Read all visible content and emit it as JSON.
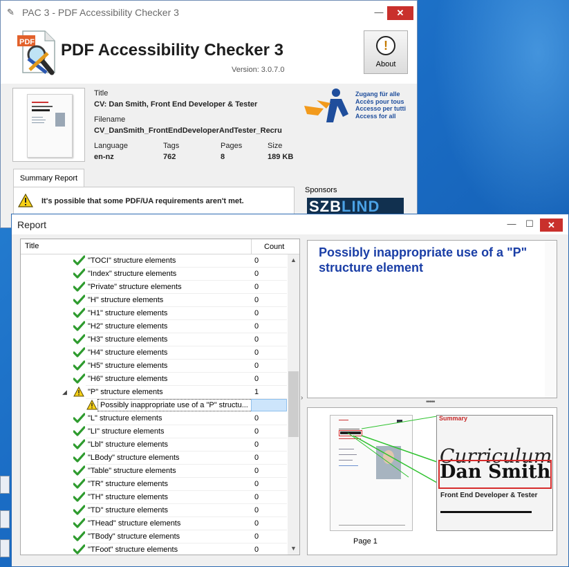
{
  "main_window": {
    "title": "PAC 3 - PDF Accessibility Checker 3",
    "app_name": "PDF Accessibility Checker 3",
    "version": "Version: 3.0.7.0",
    "about_label": "About",
    "window_buttons": {
      "minimize": "—",
      "maximize": "☐",
      "close": "✕"
    }
  },
  "document": {
    "title_label": "Title",
    "title_value": "CV: Dan Smith, Front End Developer & Tester",
    "filename_label": "Filename",
    "filename_value": "CV_DanSmith_FrontEndDeveloperAndTester_Recru",
    "language_label": "Language",
    "language_value": "en-nz",
    "tags_label": "Tags",
    "tags_value": "762",
    "pages_label": "Pages",
    "pages_value": "8",
    "size_label": "Size",
    "size_value": "189 KB"
  },
  "access_for_all": {
    "lines": [
      "Zugang für alle",
      "Accès pour tous",
      "Accesso per tutti",
      "Access for all"
    ]
  },
  "summary": {
    "tab_label": "Summary Report",
    "message": "It's possible that some PDF/UA requirements aren't met."
  },
  "sponsors": {
    "label": "Sponsors",
    "logo_part1": "SZB",
    "logo_part2": "LIND"
  },
  "report_window": {
    "title": "Report",
    "window_buttons": {
      "minimize": "—",
      "maximize": "☐",
      "close": "✕"
    },
    "columns": {
      "title": "Title",
      "count": "Count"
    },
    "rows": [
      {
        "title": "\"TOCI\" structure elements",
        "count": "0",
        "status": "pass"
      },
      {
        "title": "\"Index\" structure elements",
        "count": "0",
        "status": "pass"
      },
      {
        "title": "\"Private\" structure elements",
        "count": "0",
        "status": "pass"
      },
      {
        "title": "\"H\" structure elements",
        "count": "0",
        "status": "pass"
      },
      {
        "title": "\"H1\" structure elements",
        "count": "0",
        "status": "pass"
      },
      {
        "title": "\"H2\" structure elements",
        "count": "0",
        "status": "pass"
      },
      {
        "title": "\"H3\" structure elements",
        "count": "0",
        "status": "pass"
      },
      {
        "title": "\"H4\" structure elements",
        "count": "0",
        "status": "pass"
      },
      {
        "title": "\"H5\" structure elements",
        "count": "0",
        "status": "pass"
      },
      {
        "title": "\"H6\" structure elements",
        "count": "0",
        "status": "pass"
      },
      {
        "title": "\"P\" structure elements",
        "count": "1",
        "status": "warning",
        "expanded": true
      },
      {
        "title": "Possibly inappropriate use of a \"P\" structu...",
        "count": "",
        "status": "warning",
        "child": true,
        "selected": true
      },
      {
        "title": "\"L\" structure elements",
        "count": "0",
        "status": "pass"
      },
      {
        "title": "\"LI\" structure elements",
        "count": "0",
        "status": "pass"
      },
      {
        "title": "\"Lbl\" structure elements",
        "count": "0",
        "status": "pass"
      },
      {
        "title": "\"LBody\" structure elements",
        "count": "0",
        "status": "pass"
      },
      {
        "title": "\"Table\" structure elements",
        "count": "0",
        "status": "pass"
      },
      {
        "title": "\"TR\" structure elements",
        "count": "0",
        "status": "pass"
      },
      {
        "title": "\"TH\" structure elements",
        "count": "0",
        "status": "pass"
      },
      {
        "title": "\"TD\" structure elements",
        "count": "0",
        "status": "pass"
      },
      {
        "title": "\"THead\" structure elements",
        "count": "0",
        "status": "pass"
      },
      {
        "title": "\"TBody\" structure elements",
        "count": "0",
        "status": "pass"
      },
      {
        "title": "\"TFoot\" structure elements",
        "count": "0",
        "status": "pass"
      }
    ],
    "detail_title": "Possibly inappropriate use of a \"P\" structure element",
    "page_label": "Page 1",
    "preview": {
      "summary": "Summary",
      "cv": "Curriculum vitae",
      "name": "Dan Smith",
      "role": "Front End Developer & Tester"
    }
  },
  "colors": {
    "pass": "#2e9b2e",
    "warning": "#f2c200",
    "accent": "#1a3ea6",
    "highlight": "#d62b2b"
  }
}
